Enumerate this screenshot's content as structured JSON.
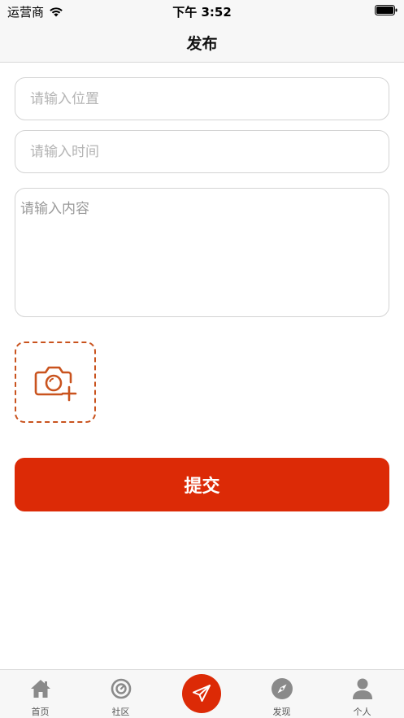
{
  "status_bar": {
    "carrier": "运营商",
    "time": "下午 3:52"
  },
  "nav": {
    "title": "发布"
  },
  "form": {
    "location_placeholder": "请输入位置",
    "location_value": "",
    "time_placeholder": "请输入时间",
    "time_value": "",
    "content_placeholder": "请输入内容",
    "content_value": "",
    "photo_icon": "camera-add-icon",
    "submit_label": "提交"
  },
  "tab_bar": {
    "items": [
      {
        "label": "首页",
        "icon": "home-icon"
      },
      {
        "label": "社区",
        "icon": "community-icon"
      },
      {
        "label": "",
        "icon": "paper-plane-icon"
      },
      {
        "label": "发现",
        "icon": "compass-icon"
      },
      {
        "label": "个人",
        "icon": "person-icon"
      }
    ]
  },
  "colors": {
    "accent": "#dc2a06",
    "dashed_border": "#c9531e",
    "bar_background": "#f7f7f7",
    "placeholder": "#b4b4b4",
    "tab_icon": "#8a8a8a"
  }
}
